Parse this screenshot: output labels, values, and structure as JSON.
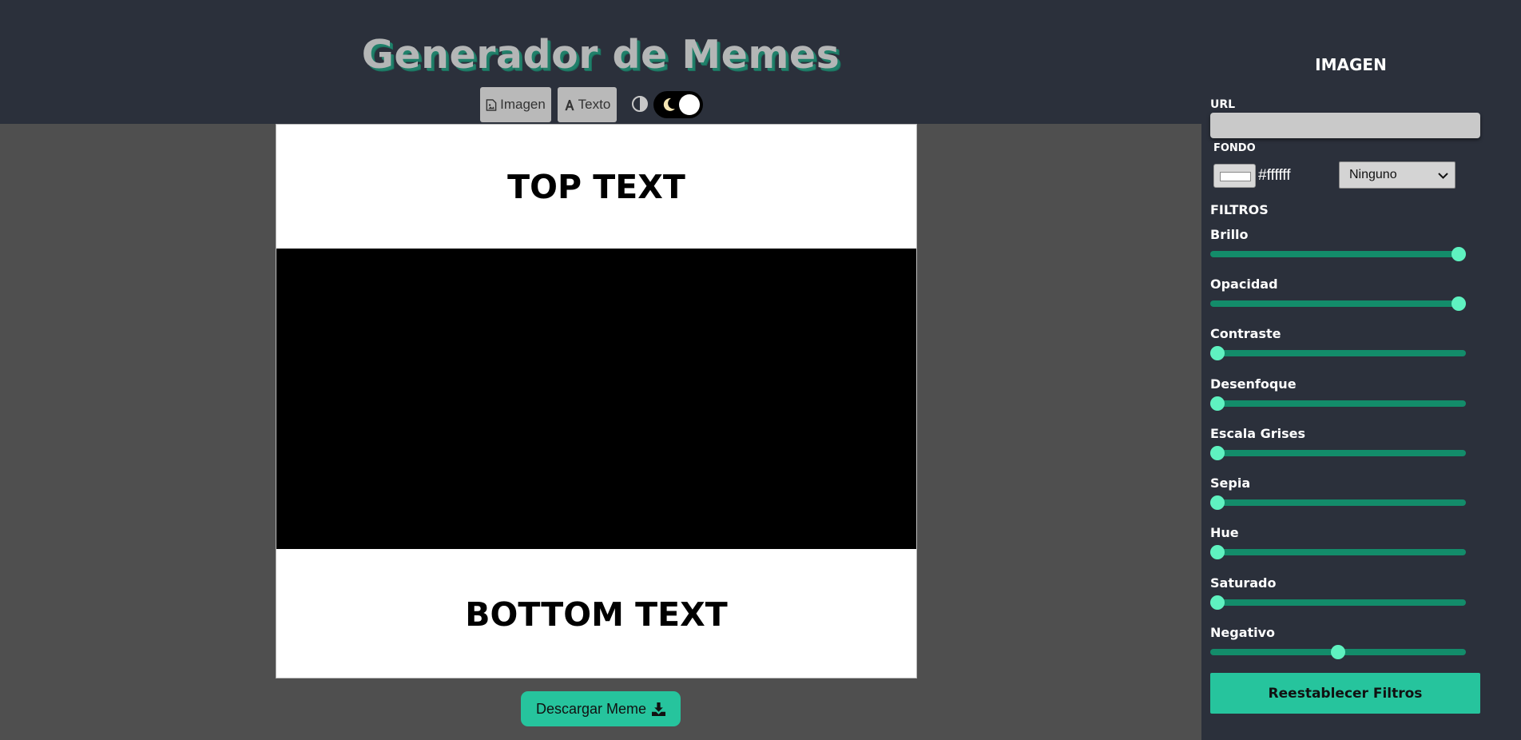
{
  "header": {
    "title": "Generador de Memes",
    "tabs": [
      {
        "label": "Imagen",
        "icon": "file-image-icon"
      },
      {
        "label": "Texto",
        "icon": "font-icon"
      }
    ],
    "theme_toggle": {
      "icon": "contrast-icon",
      "state_icon": "moon-icon",
      "enabled": true
    }
  },
  "meme": {
    "top_text": "TOP TEXT",
    "bottom_text": "BOTTOM TEXT",
    "image_fill": "#000000"
  },
  "download": {
    "label": "Descargar Meme",
    "icon": "download-icon"
  },
  "panel": {
    "title": "IMAGEN",
    "url": {
      "label": "URL",
      "value": "",
      "placeholder": ""
    },
    "fondo": {
      "label": "FONDO",
      "color_value": "#ffffff",
      "blend_mode": "Ninguno"
    },
    "filters_label": "FILTROS",
    "filters": [
      {
        "label": "Brillo",
        "level": 1.0
      },
      {
        "label": "Opacidad",
        "level": 1.0
      },
      {
        "label": "Contraste",
        "level": 0.0
      },
      {
        "label": "Desenfoque",
        "level": 0.0
      },
      {
        "label": "Escala Grises",
        "level": 0.0
      },
      {
        "label": "Sepia",
        "level": 0.0
      },
      {
        "label": "Hue",
        "level": 0.0
      },
      {
        "label": "Saturado",
        "level": 0.0
      },
      {
        "label": "Negativo",
        "level": 0.5
      }
    ],
    "reset_label": "Reestablecer Filtros"
  },
  "colors": {
    "accent": "#26c49d",
    "slider_track": "#138c6a",
    "slider_thumb": "#5ff2c0",
    "panel_bg": "#2b303b",
    "workspace_bg": "#4f4f4f"
  }
}
